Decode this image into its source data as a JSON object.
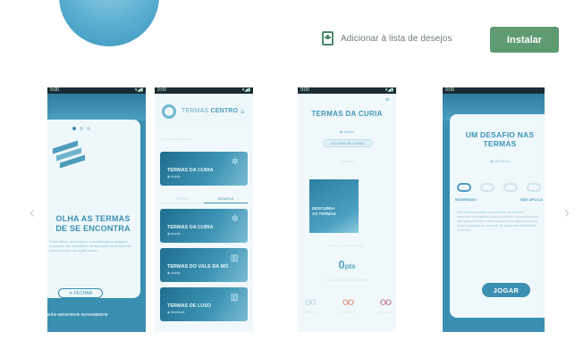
{
  "store": {
    "wishlist_label": "Adicionar à lista de desejos",
    "install_label": "Instalar"
  },
  "screenshots": [
    {
      "status_time": "9:00",
      "status_icons": "▾◢▮",
      "headline": "OLHA AS TERMAS\nDE SE ENCONTRA",
      "paragraph": "Pode alterar as termas e a localização a qualquer momento nas definições da aplicação para explorar outras termas da região centro.",
      "close_label": "✕ FECHAR",
      "footer": "NÃO MOSTRAR NOVAMENTE"
    },
    {
      "status_time": "9:00",
      "status_icons": "▾◢▮",
      "brand_prefix": "TERMAS",
      "brand_suffix": "CENTRO",
      "menu": "≡",
      "sublabel": "Escolha as termas",
      "tiles": [
        {
          "name": "TERMAS DA CURIA",
          "sub": "◉ Anadia"
        },
        {
          "name": "TERMAS DA CURIA",
          "sub": "◉ Anadia"
        },
        {
          "name": "TERMAS DO VALE DA MÓ",
          "sub": "◉ Anadia"
        },
        {
          "name": "TERMAS DE LUSO",
          "sub": "◉ Mealhada"
        }
      ],
      "tabs": [
        "TERMAS",
        "DESAFIOS"
      ]
    },
    {
      "status_time": "9:00",
      "status_icons": "▾◢▮",
      "corner": "≡",
      "title": "TERMAS DA CURIA",
      "location": "◉ Anadia",
      "pill": "A CURIA AS CURAS",
      "small": "Desafios",
      "photo_text": "DESCUBRA\nAS TERMAS",
      "faint": "Pontuação total obtida",
      "points": "0",
      "points_unit": "pts",
      "faint2": "Conquistas desbloqueadas",
      "badges": [
        "OO",
        "OO",
        "OO"
      ],
      "badge_labels": [
        "INICIANTE",
        "INTERMÉDIO",
        "AVANÇADO"
      ]
    },
    {
      "status_time": "9:00",
      "status_icons": "▾◢▮",
      "title": "UM DESAFIO NAS\nTERMAS",
      "location": "◉ Vila Nova",
      "levels": [
        "MODERADO",
        "NÃO APLICA"
      ],
      "paragraph": "Este desafio consiste em percorrer as termas e responder a perguntas sobre a história e as propriedades das águas termais. Cada resposta certa vale pontos que ficam registados no seu perfil de explorador das termas do centro.",
      "play_label": "JOGAR"
    }
  ],
  "colors": {
    "install": "#5e9b72",
    "accent": "#3b8fb0",
    "icon_ring": "#5bb0d2"
  }
}
